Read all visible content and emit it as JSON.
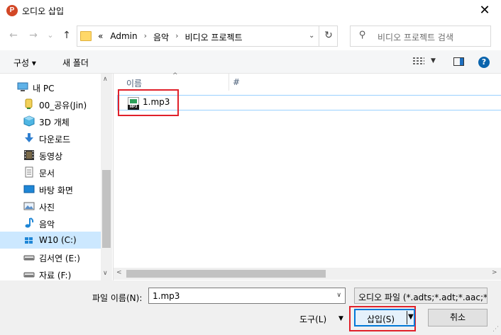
{
  "window": {
    "title": "오디오 삽입",
    "close_glyph": "✕"
  },
  "nav": {
    "back_glyph": "←",
    "forward_glyph": "→",
    "recent_glyph": "⌄",
    "up_glyph": "↑",
    "breadcrumb": {
      "overflow": "«",
      "items": [
        "Admin",
        "음악",
        "비디오 프로젝트"
      ],
      "separator": "›"
    },
    "refresh_glyph": "↻",
    "search_placeholder": "비디오 프로젝트 검색"
  },
  "toolbar": {
    "organize": "구성 ▾",
    "new_folder": "새 폴더",
    "help": "?"
  },
  "sidebar": {
    "items": [
      {
        "label": "내 PC",
        "icon": "pc-icon",
        "indent": 0
      },
      {
        "label": "00_공유(Jin)",
        "icon": "shared-folder-icon",
        "indent": 1
      },
      {
        "label": "3D 개체",
        "icon": "3d-objects-icon",
        "indent": 1
      },
      {
        "label": "다운로드",
        "icon": "downloads-icon",
        "indent": 1
      },
      {
        "label": "동영상",
        "icon": "videos-icon",
        "indent": 1
      },
      {
        "label": "문서",
        "icon": "documents-icon",
        "indent": 1
      },
      {
        "label": "바탕 화면",
        "icon": "desktop-icon",
        "indent": 1
      },
      {
        "label": "사진",
        "icon": "pictures-icon",
        "indent": 1
      },
      {
        "label": "음악",
        "icon": "music-icon",
        "indent": 1
      },
      {
        "label": "W10 (C:)",
        "icon": "windows-drive-icon",
        "indent": 1,
        "selected": true
      },
      {
        "label": "김서연 (E:)",
        "icon": "drive-icon",
        "indent": 1
      },
      {
        "label": "자료 (F:)",
        "icon": "drive-icon",
        "indent": 1
      }
    ]
  },
  "file_list": {
    "columns": [
      "이름",
      "#"
    ],
    "sort_glyph": "^",
    "files": [
      {
        "name": "1.mp3",
        "icon_text": "MP3"
      }
    ]
  },
  "footer": {
    "filename_label": "파일 이름(N):",
    "filename_value": "1.mp3",
    "filter_value": "오디오 파일 (*.adts;*.adt;*.aac;*",
    "tools_label": "도구(L)",
    "insert_label": "삽입(S)",
    "cancel_label": "취소"
  },
  "colors": {
    "highlight_red": "#e0202a",
    "selection_blue": "#cce8ff",
    "primary_button_border": "#0078d7"
  }
}
